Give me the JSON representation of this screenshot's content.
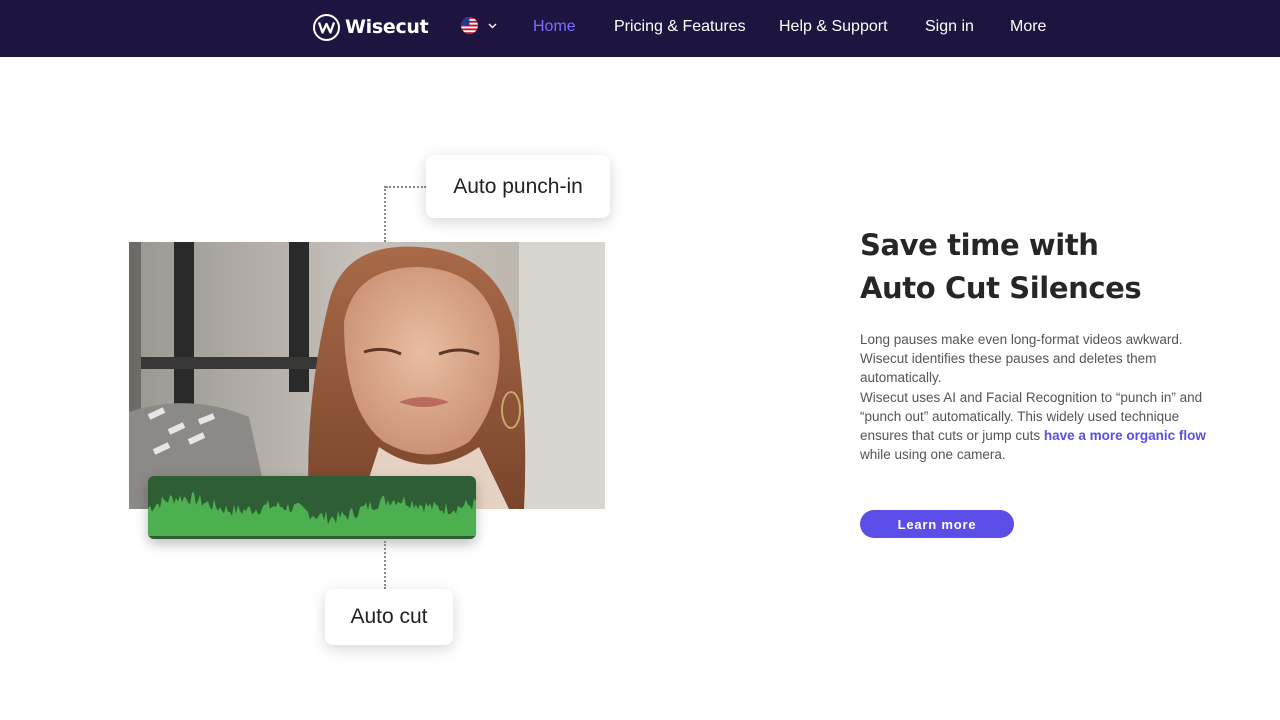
{
  "brand": {
    "name": "Wisecut",
    "logo_letter": "W"
  },
  "nav": {
    "language_icon": "us-flag-icon",
    "items": [
      {
        "label": "Home",
        "active": true
      },
      {
        "label": "Pricing & Features",
        "active": false
      },
      {
        "label": "Help & Support",
        "active": false
      },
      {
        "label": "Sign in",
        "active": false
      },
      {
        "label": "More",
        "active": false
      }
    ]
  },
  "illustration": {
    "top_tag": "Auto punch-in",
    "bottom_tag": "Auto cut"
  },
  "hero": {
    "headline_line1": "Save time with",
    "headline_line2": "Auto Cut Silences",
    "desc_line1": "Long pauses make even long-format videos awkward.",
    "desc_line2": "Wisecut identifies these pauses and deletes them",
    "desc_line3": "automatically.",
    "desc_line4": "Wisecut uses AI and Facial Recognition to “punch in” and",
    "desc_line5": "“punch out” automatically. This widely used technique",
    "desc_line6_prefix": "ensures that cuts or jump cuts ",
    "desc_line6_link": "have a more organic flow",
    "desc_line7": "while using one camera.",
    "cta_label": "Learn more"
  },
  "colors": {
    "nav_bg": "#1d1540",
    "accent": "#5b4de8",
    "nav_active": "#7b6cff",
    "waveform_bg": "#2d5e34",
    "waveform": "#4caf50"
  }
}
